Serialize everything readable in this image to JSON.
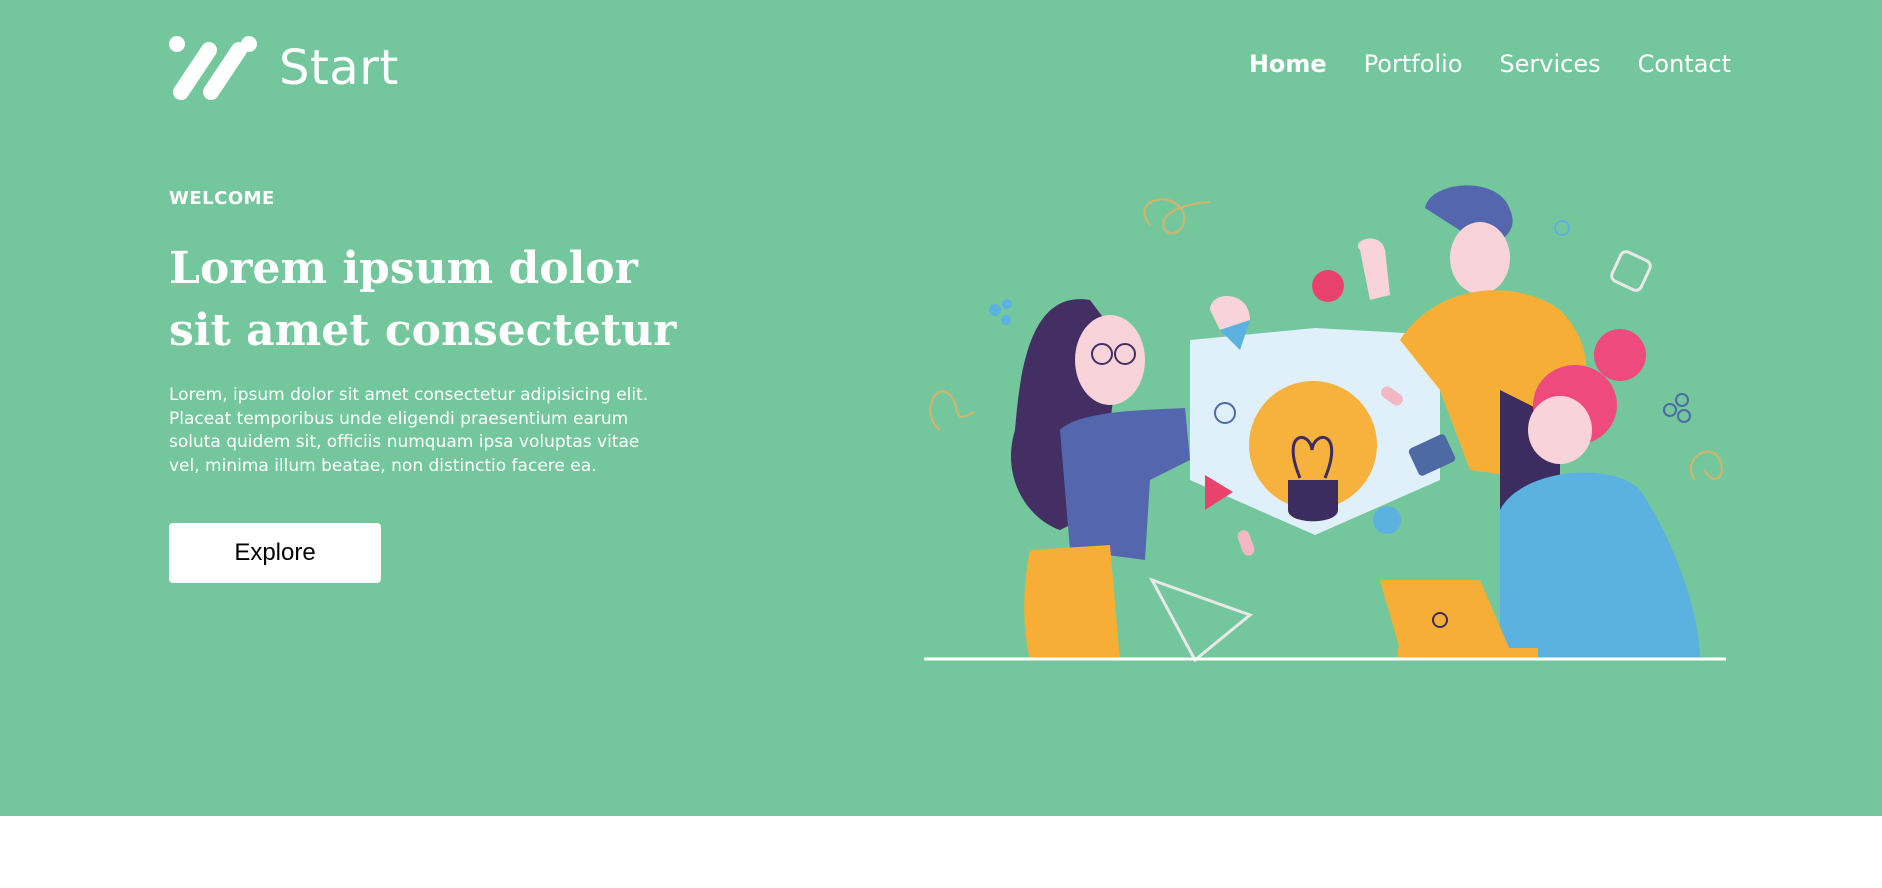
{
  "brand": {
    "name": "Start",
    "icon": "slash-stripes-logo-icon"
  },
  "nav": {
    "items": [
      {
        "label": "Home",
        "active": true
      },
      {
        "label": "Portfolio",
        "active": false
      },
      {
        "label": "Services",
        "active": false
      },
      {
        "label": "Contact",
        "active": false
      }
    ]
  },
  "hero": {
    "eyebrow": "WELCOME",
    "title": "Lorem ipsum dolor sit amet consectetur",
    "body": "Lorem, ipsum dolor sit amet consectetur adipisicing elit. Placeat temporibus unde eligendi praesentium earum soluta quidem sit, officiis numquam ipsa voluptas vitae vel, minima illum beatae, non distinctio facere ea.",
    "cta_label": "Explore",
    "illustration": "teamwork-lightbulb-illustration"
  },
  "colors": {
    "hero_background": "#74c79c",
    "text": "#ffffff",
    "button_background": "#ffffff",
    "button_text": "#000000"
  }
}
